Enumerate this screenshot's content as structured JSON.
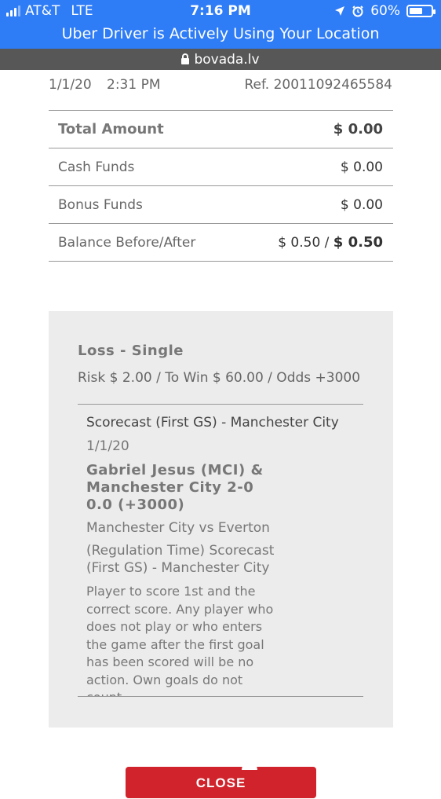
{
  "status_bar": {
    "carrier": "AT&T",
    "network": "LTE",
    "time": "7:16 PM",
    "battery": "60%",
    "battery_level": 0.6,
    "icons": [
      "signal-icon",
      "location-arrow-icon",
      "alarm-icon",
      "battery-icon"
    ],
    "location_message": "Uber Driver is Actively Using Your Location"
  },
  "url_bar": {
    "domain": "bovada.lv",
    "icon": "lock-icon"
  },
  "transaction": {
    "date": "1/1/20",
    "time": "2:31 PM",
    "ref": "Ref. 20011092465584"
  },
  "summary": {
    "total_label": "Total Amount",
    "total_value": "$ 0.00",
    "cash_label": "Cash Funds",
    "cash_value": "$ 0.00",
    "bonus_label": "Bonus Funds",
    "bonus_value": "$ 0.00",
    "balance_label": "Balance Before/After",
    "balance_before": "$ 0.50 /",
    "balance_after": "$ 0.50"
  },
  "bet": {
    "result": "Loss - Single",
    "risk_line": "Risk $ 2.00 / To Win $ 60.00 / Odds +3000",
    "market": "Scorecast (First GS) - Manchester City",
    "date": "1/1/20",
    "selection": "Gabriel Jesus (MCI) & Manchester City 2-0 0.0 (+3000)",
    "event": "Manchester City vs Everton",
    "period": "(Regulation Time) Scorecast (First GS) - Manchester City",
    "description": "Player to score 1st and the correct score. Any player who does not play or who enters the game after the first goal has been scored will be no action. Own goals do not count."
  },
  "actions": {
    "close_label": "CLOSE"
  },
  "colors": {
    "status_bar_bg": "#2e7cf6",
    "url_bar_bg": "#575757",
    "card_bg": "#ececec",
    "close_button_bg": "#d0232b"
  }
}
